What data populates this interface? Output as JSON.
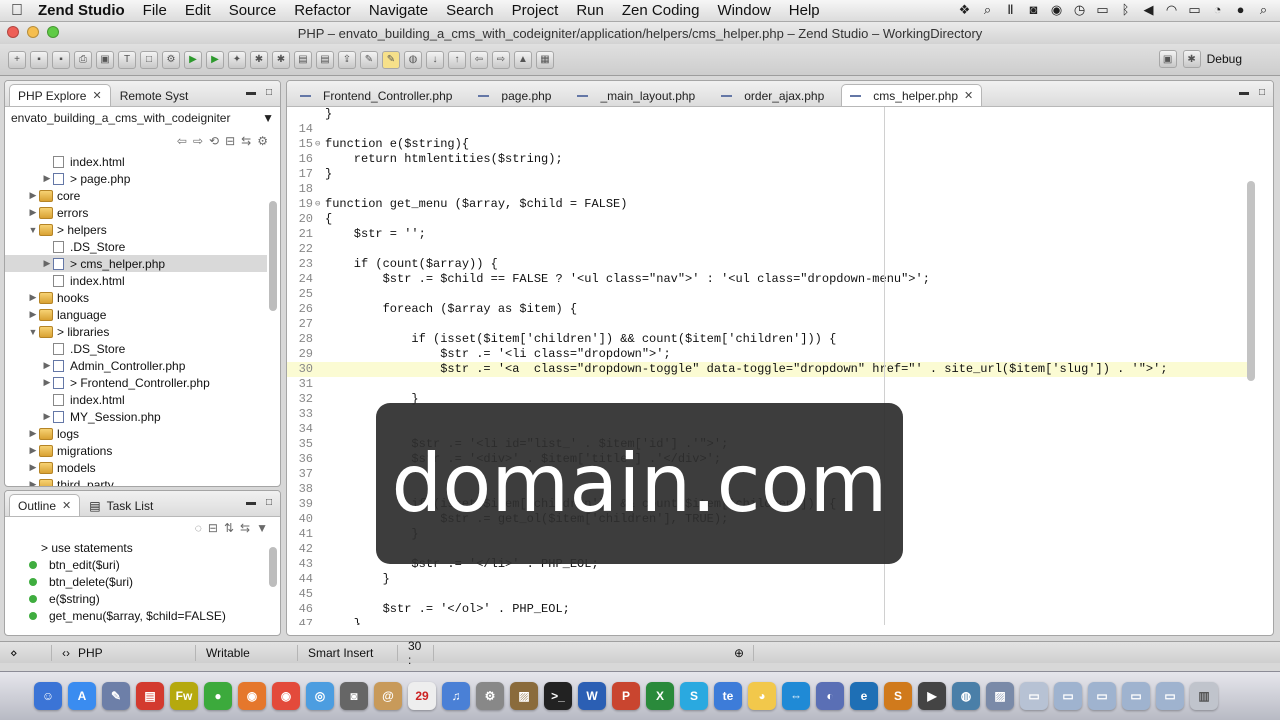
{
  "menubar": {
    "app": "Zend Studio",
    "items": [
      "File",
      "Edit",
      "Source",
      "Refactor",
      "Navigate",
      "Search",
      "Project",
      "Run",
      "Zen Coding",
      "Window",
      "Help"
    ]
  },
  "window": {
    "title": "PHP – envato_building_a_cms_with_codeigniter/application/helpers/cms_helper.php – Zend Studio – WorkingDirectory"
  },
  "toolbar": {
    "debug_label": "Debug"
  },
  "explorer": {
    "tabs": [
      {
        "label": "PHP Explore"
      },
      {
        "label": "Remote Syst"
      }
    ],
    "project": "envato_building_a_cms_with_codeigniter",
    "tree": [
      {
        "label": "index.html",
        "type": "file",
        "indent": 3,
        "twisty": ""
      },
      {
        "label": "> page.php",
        "type": "php",
        "indent": 3,
        "twisty": "▶"
      },
      {
        "label": "core",
        "type": "folder",
        "indent": 2,
        "twisty": "▶"
      },
      {
        "label": "errors",
        "type": "folder",
        "indent": 2,
        "twisty": "▶"
      },
      {
        "label": "> helpers",
        "type": "folder",
        "indent": 2,
        "twisty": "▼"
      },
      {
        "label": ".DS_Store",
        "type": "file",
        "indent": 3,
        "twisty": ""
      },
      {
        "label": "> cms_helper.php",
        "type": "php",
        "indent": 3,
        "twisty": "▶",
        "selected": true
      },
      {
        "label": "index.html",
        "type": "file",
        "indent": 3,
        "twisty": ""
      },
      {
        "label": "hooks",
        "type": "folder",
        "indent": 2,
        "twisty": "▶"
      },
      {
        "label": "language",
        "type": "folder",
        "indent": 2,
        "twisty": "▶"
      },
      {
        "label": "> libraries",
        "type": "folder",
        "indent": 2,
        "twisty": "▼"
      },
      {
        "label": ".DS_Store",
        "type": "file",
        "indent": 3,
        "twisty": ""
      },
      {
        "label": "Admin_Controller.php",
        "type": "php",
        "indent": 3,
        "twisty": "▶"
      },
      {
        "label": "> Frontend_Controller.php",
        "type": "php",
        "indent": 3,
        "twisty": "▶"
      },
      {
        "label": "index.html",
        "type": "file",
        "indent": 3,
        "twisty": ""
      },
      {
        "label": "MY_Session.php",
        "type": "php",
        "indent": 3,
        "twisty": "▶"
      },
      {
        "label": "logs",
        "type": "folder",
        "indent": 2,
        "twisty": "▶"
      },
      {
        "label": "migrations",
        "type": "folder",
        "indent": 2,
        "twisty": "▶"
      },
      {
        "label": "models",
        "type": "folder",
        "indent": 2,
        "twisty": "▶"
      },
      {
        "label": "third_party",
        "type": "folder",
        "indent": 2,
        "twisty": "▶"
      }
    ]
  },
  "outline": {
    "tabs": [
      {
        "label": "Outline"
      },
      {
        "label": "Task List"
      }
    ],
    "items": [
      "> use statements",
      "btn_edit($uri)",
      "btn_delete($uri)",
      "e($string)",
      "get_menu($array, $child=FALSE)"
    ]
  },
  "editor": {
    "tabs": [
      "Frontend_Controller.php",
      "page.php",
      "_main_layout.php",
      "order_ajax.php",
      "cms_helper.php"
    ],
    "active_tab": 4,
    "current_line": 30,
    "lines": [
      {
        "n": "",
        "fold": "",
        "text": "}"
      },
      {
        "n": "14",
        "fold": "",
        "text": ""
      },
      {
        "n": "15",
        "fold": "⊖",
        "text": "function e($string){"
      },
      {
        "n": "16",
        "fold": "",
        "text": "    return htmlentities($string);"
      },
      {
        "n": "17",
        "fold": "",
        "text": "}"
      },
      {
        "n": "18",
        "fold": "",
        "text": ""
      },
      {
        "n": "19",
        "fold": "⊖",
        "text": "function get_menu ($array, $child = FALSE)"
      },
      {
        "n": "20",
        "fold": "",
        "text": "{"
      },
      {
        "n": "21",
        "fold": "",
        "text": "    $str = '';"
      },
      {
        "n": "22",
        "fold": "",
        "text": ""
      },
      {
        "n": "23",
        "fold": "",
        "text": "    if (count($array)) {"
      },
      {
        "n": "24",
        "fold": "",
        "text": "        $str .= $child == FALSE ? '<ul class=\"nav\">' : '<ul class=\"dropdown-menu\">';"
      },
      {
        "n": "25",
        "fold": "",
        "text": ""
      },
      {
        "n": "26",
        "fold": "",
        "text": "        foreach ($array as $item) {"
      },
      {
        "n": "27",
        "fold": "",
        "text": ""
      },
      {
        "n": "28",
        "fold": "",
        "text": "            if (isset($item['children']) && count($item['children'])) {"
      },
      {
        "n": "29",
        "fold": "",
        "text": "                $str .= '<li class=\"dropdown\">';"
      },
      {
        "n": "30",
        "fold": "",
        "text": "                $str .= '<a  class=\"dropdown-toggle\" data-toggle=\"dropdown\" href=\"' . site_url($item['slug']) . '\">';"
      },
      {
        "n": "31",
        "fold": "",
        "text": ""
      },
      {
        "n": "32",
        "fold": "",
        "text": "            }"
      },
      {
        "n": "33",
        "fold": "",
        "text": ""
      },
      {
        "n": "34",
        "fold": "",
        "text": ""
      },
      {
        "n": "35",
        "fold": "",
        "text": "            $str .= '<li id=\"list_' . $item['id'] .'\">';"
      },
      {
        "n": "36",
        "fold": "",
        "text": "            $str .= '<div>' . $item['title'] .'</div>';"
      },
      {
        "n": "37",
        "fold": "",
        "text": ""
      },
      {
        "n": "38",
        "fold": "",
        "text": ""
      },
      {
        "n": "39",
        "fold": "",
        "text": "            if (isset($item['children']) && count($item['children'])) {"
      },
      {
        "n": "40",
        "fold": "",
        "text": "                $str .= get_ol($item['children'], TRUE);"
      },
      {
        "n": "41",
        "fold": "",
        "text": "            }"
      },
      {
        "n": "42",
        "fold": "",
        "text": ""
      },
      {
        "n": "43",
        "fold": "",
        "text": "            $str .= '</li>' . PHP_EOL;"
      },
      {
        "n": "44",
        "fold": "",
        "text": "        }"
      },
      {
        "n": "45",
        "fold": "",
        "text": ""
      },
      {
        "n": "46",
        "fold": "",
        "text": "        $str .= '</ol>' . PHP_EOL;"
      },
      {
        "n": "47",
        "fold": "",
        "text": "    }"
      }
    ]
  },
  "overlay": {
    "text": "domain.com"
  },
  "statusbar": {
    "language": "PHP",
    "mode": "Writable",
    "insert": "Smart Insert",
    "position": "30 :"
  },
  "colors": {
    "keyword": "#6c2b85",
    "string": "#2a00ff",
    "current_line": "#fbfbd3",
    "selection": "#c8d8f0"
  }
}
